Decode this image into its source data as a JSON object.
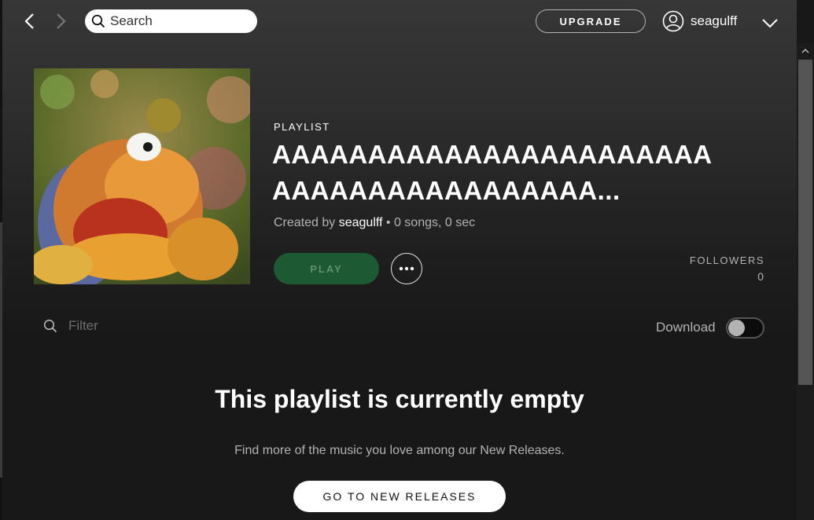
{
  "topbar": {
    "search_placeholder": "Search",
    "upgrade_label": "UPGRADE",
    "username": "seagulff"
  },
  "playlist": {
    "type_label": "PLAYLIST",
    "title": "AAAAAAAAAAAAAAAAAAAAAAAAAAAAAAAAAAAAAAAA...",
    "created_by_prefix": "Created by",
    "creator": "seagulff",
    "stats": " • 0 songs, 0 sec",
    "play_label": "PLAY",
    "followers_label": "FOLLOWERS",
    "followers_count": "0"
  },
  "tracklist": {
    "filter_placeholder": "Filter",
    "download_label": "Download",
    "download_enabled": false
  },
  "empty_state": {
    "title": "This playlist is currently empty",
    "subtitle": "Find more of the music you love among our New Releases.",
    "button_label": "GO TO NEW RELEASES"
  },
  "colors": {
    "play_button": "#1d5a34",
    "background": "#181818"
  },
  "icons": {
    "back": "chevron-left-icon",
    "forward": "chevron-right-icon",
    "search": "search-icon",
    "user": "user-icon",
    "dropdown": "chevron-down-icon",
    "more": "more-dots-icon",
    "filter": "search-icon",
    "scroll_up": "scroll-up-arrow-icon"
  }
}
